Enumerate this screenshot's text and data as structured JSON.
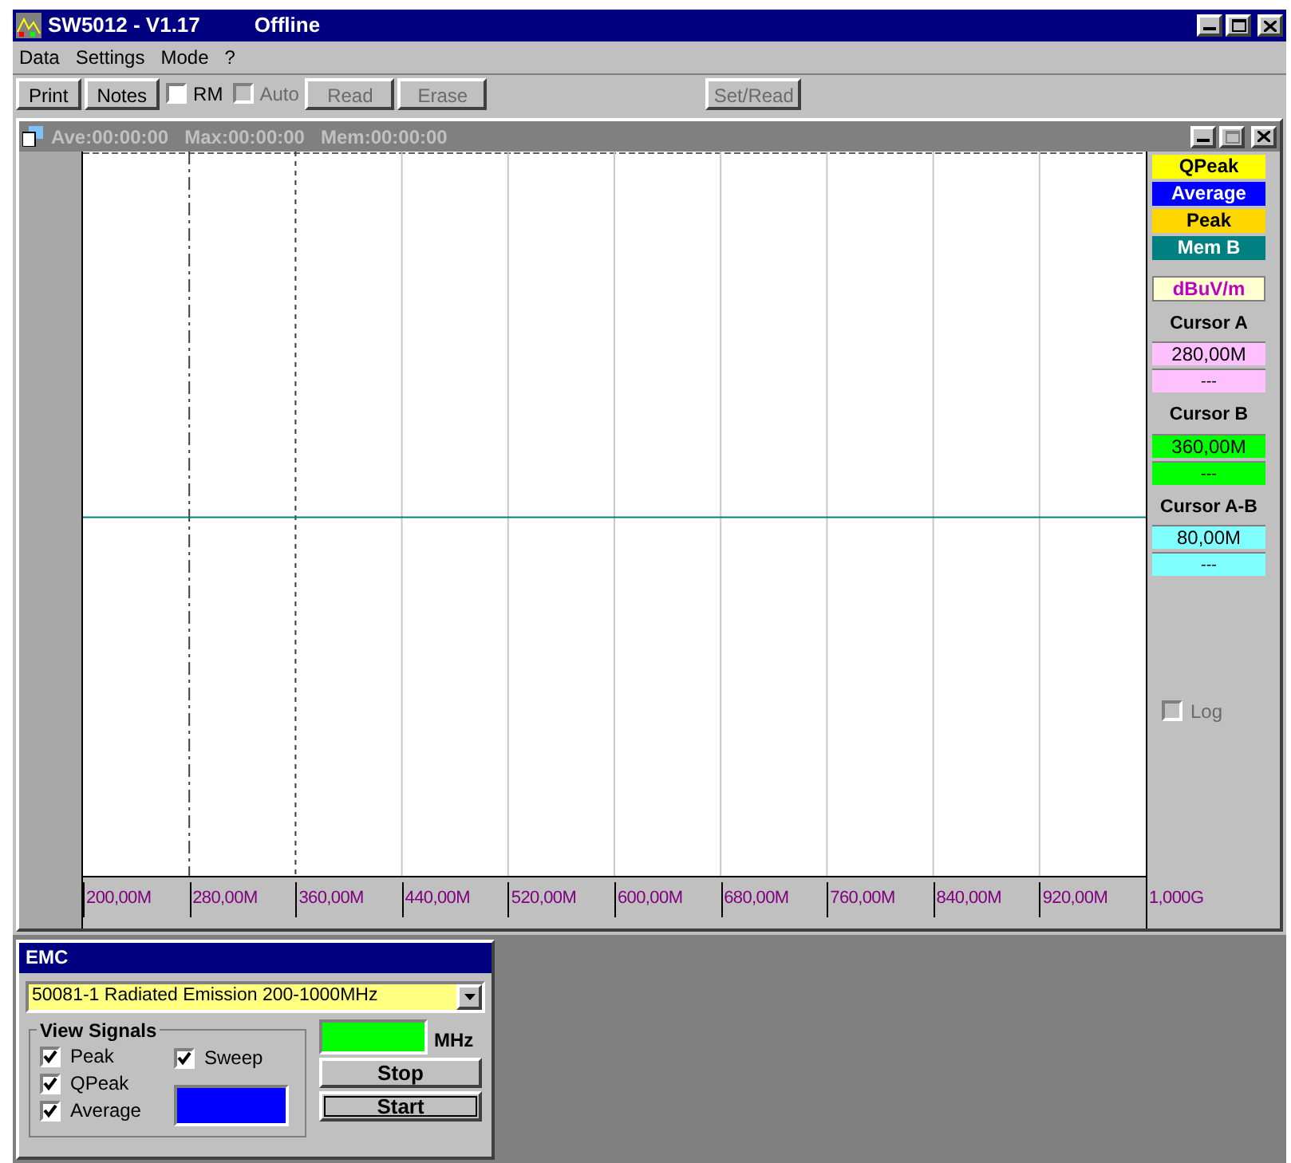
{
  "window": {
    "title": "SW5012 - V1.17",
    "status": "Offline"
  },
  "menu": [
    {
      "label": "Data"
    },
    {
      "label": "Settings"
    },
    {
      "label": "Mode"
    },
    {
      "label": "?"
    }
  ],
  "toolbar": [
    {
      "kind": "button",
      "label": "Print",
      "disabled": false
    },
    {
      "kind": "button",
      "label": "Notes",
      "disabled": false
    },
    {
      "kind": "checkbox",
      "label": "RM",
      "checked": false,
      "disabled": false
    },
    {
      "kind": "checkbox",
      "label": "Auto",
      "checked": false,
      "disabled": true
    },
    {
      "kind": "button",
      "label": "Read",
      "disabled": true
    },
    {
      "kind": "button",
      "label": "Erase",
      "disabled": true
    }
  ],
  "set_read_button": {
    "label": "Set/Read",
    "disabled": true
  },
  "plot_window": {
    "title": "Ave:00:00:00   Max:00:00:00   Mem:00:00:00",
    "x_ticks": [
      {
        "label": "200,00M",
        "kind": "edge"
      },
      {
        "label": "280,00M",
        "kind": "cursor_a"
      },
      {
        "label": "360,00M",
        "kind": "cursor_b"
      },
      {
        "label": "440,00M",
        "kind": "grid"
      },
      {
        "label": "520,00M",
        "kind": "grid"
      },
      {
        "label": "600,00M",
        "kind": "grid"
      },
      {
        "label": "680,00M",
        "kind": "grid"
      },
      {
        "label": "760,00M",
        "kind": "grid"
      },
      {
        "label": "840,00M",
        "kind": "grid"
      },
      {
        "label": "920,00M",
        "kind": "grid"
      },
      {
        "label": "1,000G",
        "kind": "edge"
      }
    ],
    "legend": [
      {
        "label": "QPeak",
        "color": "#ffff00"
      },
      {
        "label": "Average",
        "color": "#0000ff"
      },
      {
        "label": "Peak",
        "color": "#ffd700"
      },
      {
        "label": "Mem B",
        "color": "#008080"
      }
    ],
    "unit": "dBuV/m",
    "cursors": [
      {
        "title": "Cursor A",
        "value": "280,00M",
        "reading": "---",
        "color": "#ffc0ff"
      },
      {
        "title": "Cursor B",
        "value": "360,00M",
        "reading": "---",
        "color": "#00ff00"
      },
      {
        "title": "Cursor A-B",
        "value": "80,00M",
        "reading": "---",
        "color": "#80ffff"
      }
    ],
    "log": {
      "label": "Log",
      "checked": false,
      "disabled": true
    }
  },
  "emc_panel": {
    "title": "EMC",
    "test": "50081-1 Radiated Emission 200-1000MHz",
    "view_signals": {
      "title": "View Signals",
      "items": [
        {
          "label": "Peak",
          "checked": true
        },
        {
          "label": "QPeak",
          "checked": true
        },
        {
          "label": "Average",
          "checked": true
        }
      ],
      "sweep": {
        "label": "Sweep",
        "checked": true
      }
    },
    "unit": "MHz",
    "buttons": [
      {
        "label": "Stop",
        "focused": false
      },
      {
        "label": "Start",
        "focused": true
      }
    ]
  }
}
